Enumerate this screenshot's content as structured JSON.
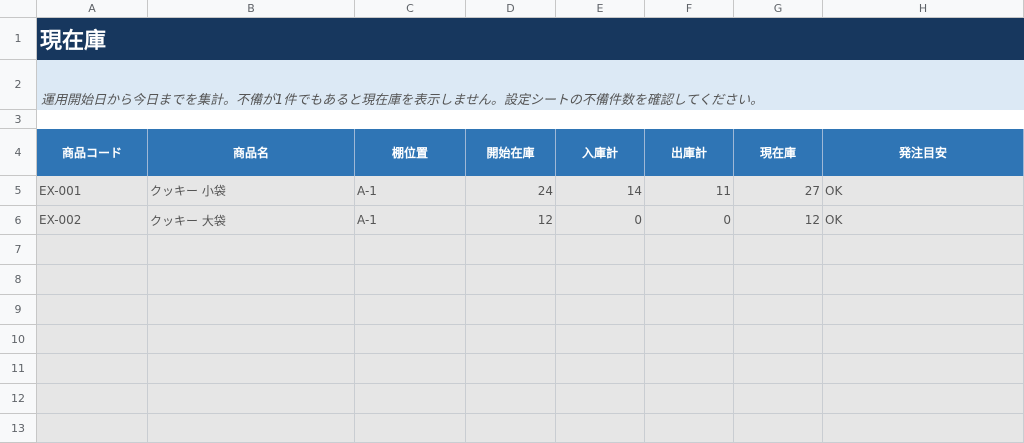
{
  "columns": [
    "A",
    "B",
    "C",
    "D",
    "E",
    "F",
    "G",
    "H"
  ],
  "rows": [
    "1",
    "2",
    "3",
    "4",
    "5",
    "6",
    "7",
    "8",
    "9",
    "10",
    "11",
    "12",
    "13"
  ],
  "title": "現在庫",
  "note": "運用開始日から今日までを集計。不備が1件でもあると現在庫を表示しません。設定シートの不備件数を確認してください。",
  "headers": [
    "商品コード",
    "商品名",
    "棚位置",
    "開始在庫",
    "入庫計",
    "出庫計",
    "現在庫",
    "発注目安"
  ],
  "data_rows": [
    [
      "EX-001",
      "クッキー 小袋",
      "A-1",
      "24",
      "14",
      "11",
      "27",
      "OK"
    ],
    [
      "EX-002",
      "クッキー 大袋",
      "A-1",
      "12",
      "0",
      "0",
      "12",
      "OK"
    ],
    [
      "",
      "",
      "",
      "",
      "",
      "",
      "",
      ""
    ],
    [
      "",
      "",
      "",
      "",
      "",
      "",
      "",
      ""
    ],
    [
      "",
      "",
      "",
      "",
      "",
      "",
      "",
      ""
    ],
    [
      "",
      "",
      "",
      "",
      "",
      "",
      "",
      ""
    ],
    [
      "",
      "",
      "",
      "",
      "",
      "",
      "",
      ""
    ],
    [
      "",
      "",
      "",
      "",
      "",
      "",
      "",
      ""
    ],
    [
      "",
      "",
      "",
      "",
      "",
      "",
      "",
      ""
    ]
  ],
  "numeric_columns": [
    3,
    4,
    5,
    6
  ]
}
